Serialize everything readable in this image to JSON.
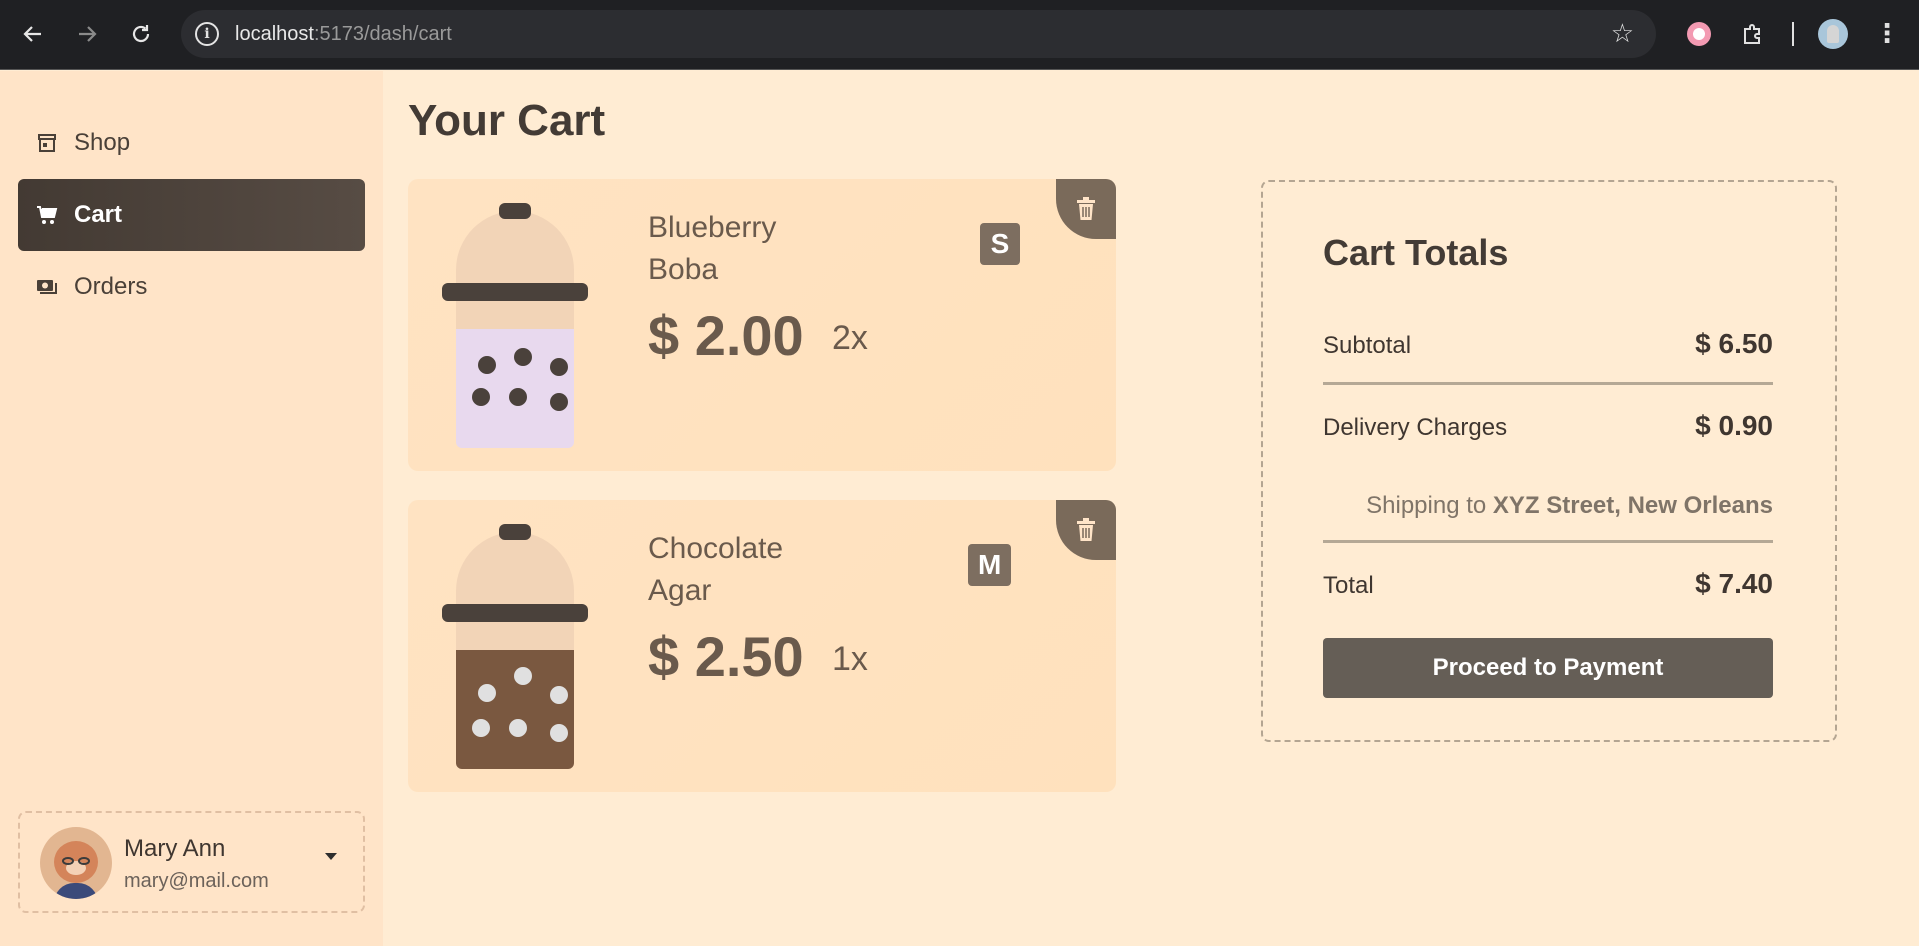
{
  "browser": {
    "url_host": "localhost",
    "url_path": ":5173/dash/cart"
  },
  "sidebar": {
    "items": [
      {
        "label": "Shop",
        "icon": "store-icon"
      },
      {
        "label": "Cart",
        "icon": "cart-icon",
        "active": true
      },
      {
        "label": "Orders",
        "icon": "money-icon"
      }
    ],
    "user": {
      "name": "Mary Ann",
      "email": "mary@mail.com"
    }
  },
  "main": {
    "title": "Your Cart",
    "items": [
      {
        "name": "Blueberry Boba",
        "price": "$ 2.00",
        "qty": "2x",
        "size": "S",
        "liquid_color": "#e8d9ee",
        "pearl_color": "#4a413b"
      },
      {
        "name": "Chocolate Agar",
        "price": "$ 2.50",
        "qty": "1x",
        "size": "M",
        "liquid_color": "#7a5840",
        "pearl_color": "#e0e0e0"
      }
    ]
  },
  "totals": {
    "title": "Cart Totals",
    "subtotal_label": "Subtotal",
    "subtotal_value": "$ 6.50",
    "delivery_label": "Delivery Charges",
    "delivery_value": "$ 0.90",
    "shipping_prefix": "Shipping to",
    "shipping_address": "XYZ Street, New Orleans",
    "total_label": "Total",
    "total_value": "$ 7.40",
    "pay_button": "Proceed to Payment"
  },
  "colors": {
    "page_bg": "#ffecd3",
    "sidebar_bg": "#ffe4c8",
    "active_bg": "#433a33",
    "accent_brown": "#7d6e60"
  }
}
